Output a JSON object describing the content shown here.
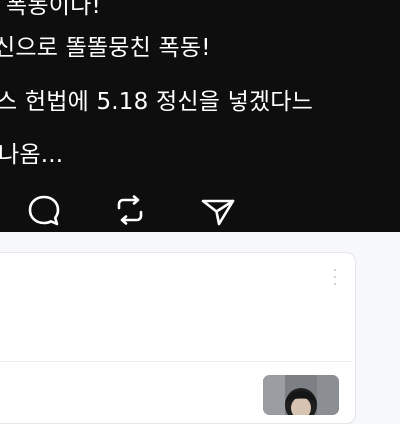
{
  "post": {
    "lines": [
      "폭동이다!",
      "신으로 똘똘뭉친 폭동!",
      "스 헌법에 5.18 정신을 넣겠다느",
      "나옴..."
    ]
  },
  "actions": {
    "icons": [
      "reply-icon",
      "repost-icon",
      "share-icon"
    ]
  },
  "card": {
    "menu_icon": "more-vertical-icon"
  },
  "colors": {
    "post_background": "#0e0e0e",
    "post_text": "#ffffff",
    "page_background": "#f7f8fa",
    "card_background": "#ffffff",
    "muted_icon": "#b9bcc2"
  }
}
